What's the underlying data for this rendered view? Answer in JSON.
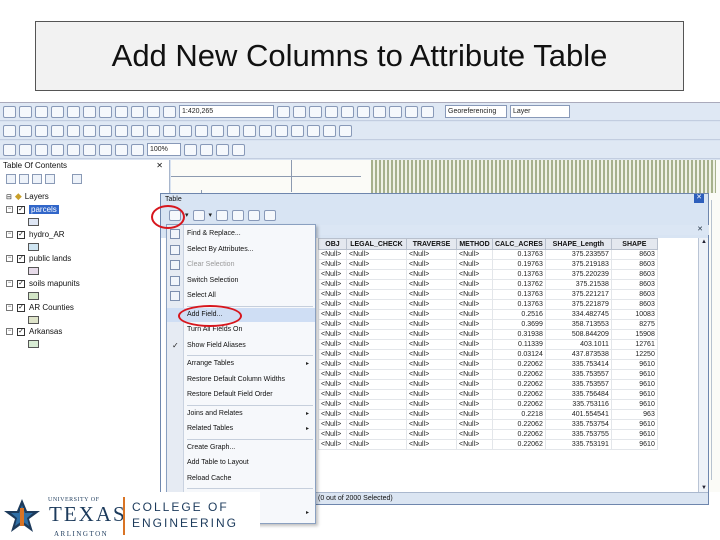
{
  "slide": {
    "title": "Add New Columns to Attribute Table"
  },
  "toolbar": {
    "scale_value": "1:420,265",
    "georef_label": "Georeferencing",
    "layer_label": "Layer",
    "zoom_value": "100%"
  },
  "toc": {
    "title": "Table Of Contents",
    "root": "Layers",
    "layers": [
      {
        "name": "parcels",
        "selected": true,
        "swatch": "#dfe7f5"
      },
      {
        "name": "hydro_AR",
        "selected": false,
        "swatch": "#cfe5f2"
      },
      {
        "name": "public lands",
        "selected": false,
        "swatch": "#e7dbe9"
      },
      {
        "name": "soils mapunits",
        "selected": false,
        "swatch": "#d3e6c7"
      },
      {
        "name": "AR Counties",
        "selected": false,
        "swatch": "#dfe4ca"
      },
      {
        "name": "Arkansas",
        "selected": false,
        "swatch": "#d8ecd4"
      }
    ]
  },
  "table_window": {
    "title": "Table",
    "columns": [
      "OBJ",
      "LEGAL_CHECK",
      "TRAVERSE",
      "METHOD",
      "CALC_ACRES",
      "SHAPE_Length",
      "SHAPE"
    ],
    "rows": [
      [
        "<Null>",
        "<Null>",
        "<Null>",
        "<Null>",
        "0.13763",
        "375.233557",
        "8603"
      ],
      [
        "<Null>",
        "<Null>",
        "<Null>",
        "<Null>",
        "0.19763",
        "375.219183",
        "8603"
      ],
      [
        "<Null>",
        "<Null>",
        "<Null>",
        "<Null>",
        "0.13763",
        "375.220239",
        "8603"
      ],
      [
        "<Null>",
        "<Null>",
        "<Null>",
        "<Null>",
        "0.13762",
        "375.21538",
        "8603"
      ],
      [
        "<Null>",
        "<Null>",
        "<Null>",
        "<Null>",
        "0.13763",
        "375.221217",
        "8603"
      ],
      [
        "<Null>",
        "<Null>",
        "<Null>",
        "<Null>",
        "0.13763",
        "375.221879",
        "8603"
      ],
      [
        "<Null>",
        "<Null>",
        "<Null>",
        "<Null>",
        "0.2516",
        "334.482745",
        "10083"
      ],
      [
        "<Null>",
        "<Null>",
        "<Null>",
        "<Null>",
        "0.3699",
        "358.713553",
        "8275"
      ],
      [
        "<Null>",
        "<Null>",
        "<Null>",
        "<Null>",
        "0.31938",
        "508.844209",
        "15908"
      ],
      [
        "<Null>",
        "<Null>",
        "<Null>",
        "<Null>",
        "0.11339",
        "403.1011",
        "12761"
      ],
      [
        "<Null>",
        "<Null>",
        "<Null>",
        "<Null>",
        "0.03124",
        "437.873538",
        "12250"
      ],
      [
        "<Null>",
        "<Null>",
        "<Null>",
        "<Null>",
        "0.22062",
        "335.753414",
        "9610"
      ],
      [
        "<Null>",
        "<Null>",
        "<Null>",
        "<Null>",
        "0.22062",
        "335.753557",
        "9610"
      ],
      [
        "<Null>",
        "<Null>",
        "<Null>",
        "<Null>",
        "0.22062",
        "335.753557",
        "9610"
      ],
      [
        "<Null>",
        "<Null>",
        "<Null>",
        "<Null>",
        "0.22062",
        "335.756484",
        "9610"
      ],
      [
        "<Null>",
        "<Null>",
        "<Null>",
        "<Null>",
        "0.22062",
        "335.753116",
        "9610"
      ],
      [
        "<Null>",
        "<Null>",
        "<Null>",
        "<Null>",
        "0.2218",
        "401.554541",
        "963"
      ],
      [
        "<Null>",
        "<Null>",
        "<Null>",
        "<Null>",
        "0.22062",
        "335.753754",
        "9610"
      ],
      [
        "<Null>",
        "<Null>",
        "<Null>",
        "<Null>",
        "0.22062",
        "335.753755",
        "9610"
      ],
      [
        "<Null>",
        "<Null>",
        "<Null>",
        "<Null>",
        "0.22062",
        "335.753191",
        "9610"
      ]
    ],
    "left_col_value": "2000",
    "status_text": "(0 out of 2000 Selected)"
  },
  "menu": {
    "items": [
      {
        "label": "Find & Replace...",
        "icon": "find-icon",
        "disabled": false,
        "submenu": false,
        "checked": false
      },
      {
        "label": "Select By Attributes...",
        "icon": "select-attributes-icon",
        "disabled": false,
        "submenu": false,
        "checked": false
      },
      {
        "label": "Clear Selection",
        "icon": "clear-selection-icon",
        "disabled": true,
        "submenu": false,
        "checked": false
      },
      {
        "label": "Switch Selection",
        "icon": "switch-selection-icon",
        "disabled": false,
        "submenu": false,
        "checked": false
      },
      {
        "label": "Select All",
        "icon": "select-all-icon",
        "disabled": false,
        "submenu": false,
        "checked": false
      },
      {
        "label": "Add Field...",
        "icon": "",
        "disabled": false,
        "submenu": false,
        "checked": false
      },
      {
        "label": "Turn All Fields On",
        "icon": "",
        "disabled": false,
        "submenu": false,
        "checked": false
      },
      {
        "label": "Show Field Aliases",
        "icon": "",
        "disabled": false,
        "submenu": false,
        "checked": true
      },
      {
        "label": "Arrange Tables",
        "icon": "",
        "disabled": false,
        "submenu": true,
        "checked": false
      },
      {
        "label": "Restore Default Column Widths",
        "icon": "",
        "disabled": false,
        "submenu": false,
        "checked": false
      },
      {
        "label": "Restore Default Field Order",
        "icon": "",
        "disabled": false,
        "submenu": false,
        "checked": false
      },
      {
        "label": "Joins and Relates",
        "icon": "",
        "disabled": false,
        "submenu": true,
        "checked": false
      },
      {
        "label": "Related Tables",
        "icon": "",
        "disabled": false,
        "submenu": true,
        "checked": false
      },
      {
        "label": "Create Graph...",
        "icon": "",
        "disabled": false,
        "submenu": false,
        "checked": false
      },
      {
        "label": "Add Table to Layout",
        "icon": "",
        "disabled": false,
        "submenu": false,
        "checked": false
      },
      {
        "label": "Reload Cache",
        "icon": "",
        "disabled": false,
        "submenu": false,
        "checked": false
      },
      {
        "label": "Print...",
        "icon": "",
        "disabled": false,
        "submenu": false,
        "checked": false
      },
      {
        "label": "Reports",
        "icon": "",
        "disabled": false,
        "submenu": true,
        "checked": false
      }
    ]
  },
  "logo": {
    "university": "UNIVERSITY OF",
    "texas": "TEXAS",
    "arlington": "ARLINGTON",
    "college_line1": "COLLEGE OF",
    "college_line2": "ENGINEERING"
  },
  "colors": {
    "highlight_circle": "#d7161d",
    "logo_blue": "#1d3b5c",
    "logo_orange": "#d97425"
  }
}
